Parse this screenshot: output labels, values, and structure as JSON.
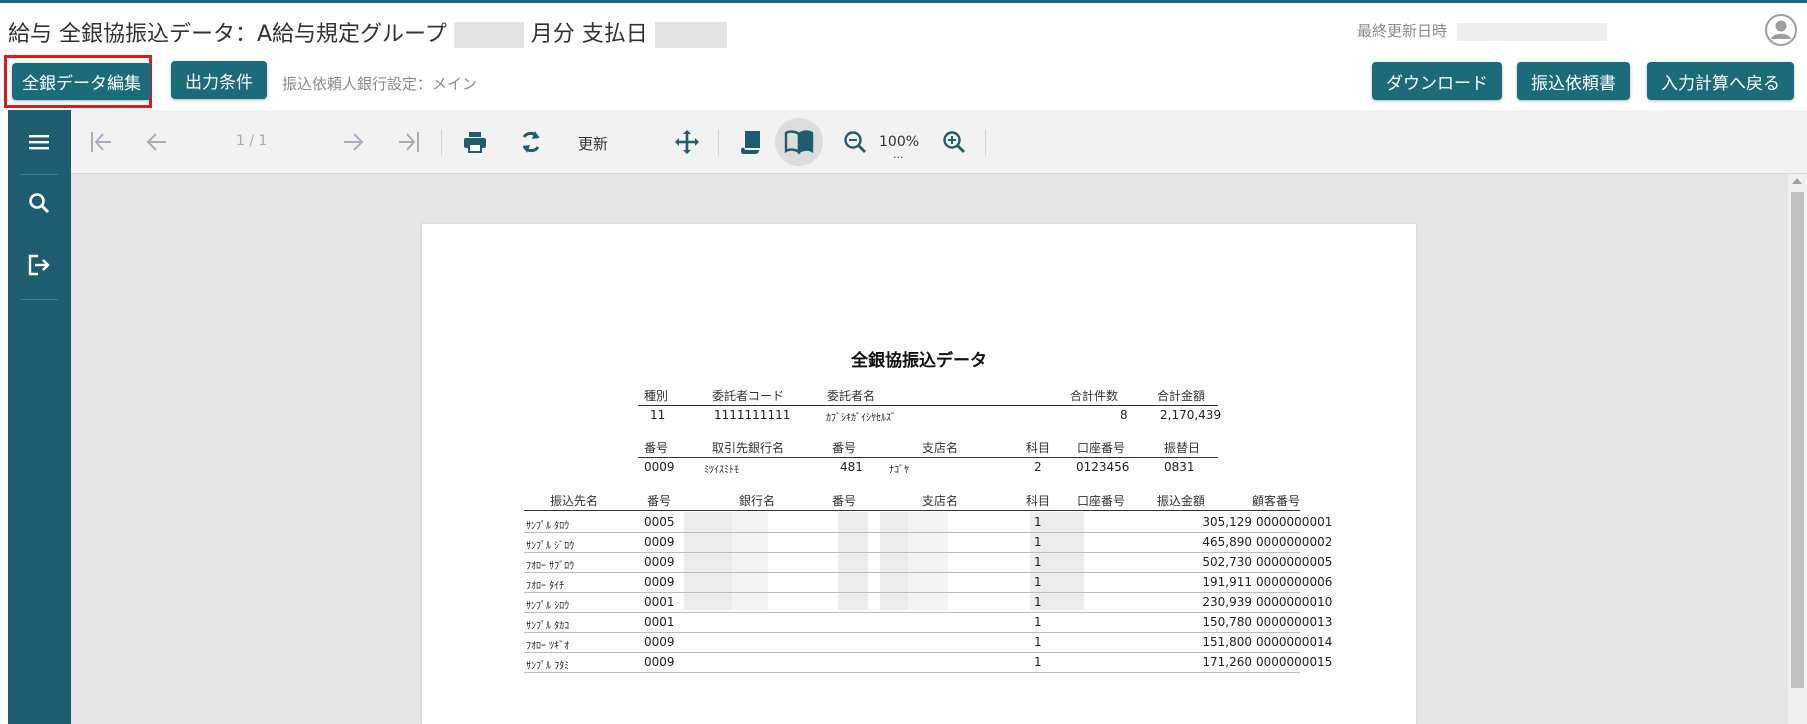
{
  "header": {
    "title_prefix": "給与 全銀協振込データ：A給与規定グループ",
    "title_month_suffix": "月分 支払日",
    "last_updated_label": "最終更新日時",
    "bank_setting_text": "振込依頼人銀行設定：メイン"
  },
  "buttons": {
    "edit_all": "全銀データ編集",
    "output_conditions": "出力条件",
    "download": "ダウンロード",
    "transfer_request": "振込依頼書",
    "back_to_input": "入力計算へ戻る"
  },
  "viewer": {
    "page_indicator": "1 / 1",
    "refresh_label": "更新",
    "zoom": "100%",
    "zoom_more": "..."
  },
  "icons": {
    "menu": "menu-icon",
    "search": "search-icon",
    "export": "export-icon",
    "first": "first-page-icon",
    "prev": "previous-page-icon",
    "next": "next-page-icon",
    "last": "last-page-icon",
    "print": "print-icon",
    "refresh": "refresh-icon",
    "move": "pan-icon",
    "continuous": "continuous-view-icon",
    "book": "book-view-icon",
    "zoom_out": "zoom-out-icon",
    "zoom_in": "zoom-in-icon",
    "user": "user-avatar-icon"
  },
  "colors": {
    "brand": "#1c6b7a",
    "rail": "#1e5d70",
    "highlight": "#e01b1b"
  },
  "report": {
    "title": "全銀協振込データ",
    "header1": {
      "labels": [
        "種別",
        "委託者コード",
        "委託者名",
        "合計件数",
        "合計金額"
      ],
      "values": [
        "11",
        "1111111111",
        "ｶﾌﾞｼｷｶﾞｲｼﾔｾﾙｽﾞ",
        "8",
        "2,170,439"
      ]
    },
    "header2": {
      "labels": [
        "番号",
        "取引先銀行名",
        "番号",
        "支店名",
        "科目",
        "口座番号",
        "振替日"
      ],
      "values": [
        "0009",
        "ﾐﾂｲｽﾐﾄﾓ",
        "481",
        "ﾅｺﾞﾔ",
        "2",
        "0123456",
        "0831"
      ]
    },
    "detail_headers": [
      "振込先名",
      "番号",
      "銀行名",
      "番号",
      "支店名",
      "科目",
      "口座番号",
      "振込金額",
      "顧客番号"
    ],
    "rows": [
      {
        "name": "ｻﾝﾌﾟﾙ ﾀﾛｳ",
        "bank_no": "0005",
        "type": "1",
        "amount": "305,129",
        "customer": "0000000001"
      },
      {
        "name": "ｻﾝﾌﾟﾙ ｼﾞﾛｳ",
        "bank_no": "0009",
        "type": "1",
        "amount": "465,890",
        "customer": "0000000002"
      },
      {
        "name": "ﾌｵﾛｰ ｻﾌﾞﾛｳ",
        "bank_no": "0009",
        "type": "1",
        "amount": "502,730",
        "customer": "0000000005"
      },
      {
        "name": "ﾌｵﾛｰ ﾀｲﾁ",
        "bank_no": "0009",
        "type": "1",
        "amount": "191,911",
        "customer": "0000000006"
      },
      {
        "name": "ｻﾝﾌﾟﾙ ｼﾛｳ",
        "bank_no": "0001",
        "type": "1",
        "amount": "230,939",
        "customer": "0000000010"
      },
      {
        "name": "ｻﾝﾌﾟﾙ ﾀｶｺ",
        "bank_no": "0001",
        "type": "1",
        "amount": "150,780",
        "customer": "0000000013"
      },
      {
        "name": "ﾌｵﾛｰ ﾂｷﾞｵ",
        "bank_no": "0009",
        "type": "1",
        "amount": "151,800",
        "customer": "0000000014"
      },
      {
        "name": "ｻﾝﾌﾟﾙ ﾌﾀﾐ",
        "bank_no": "0009",
        "type": "1",
        "amount": "171,260",
        "customer": "0000000015"
      }
    ]
  }
}
